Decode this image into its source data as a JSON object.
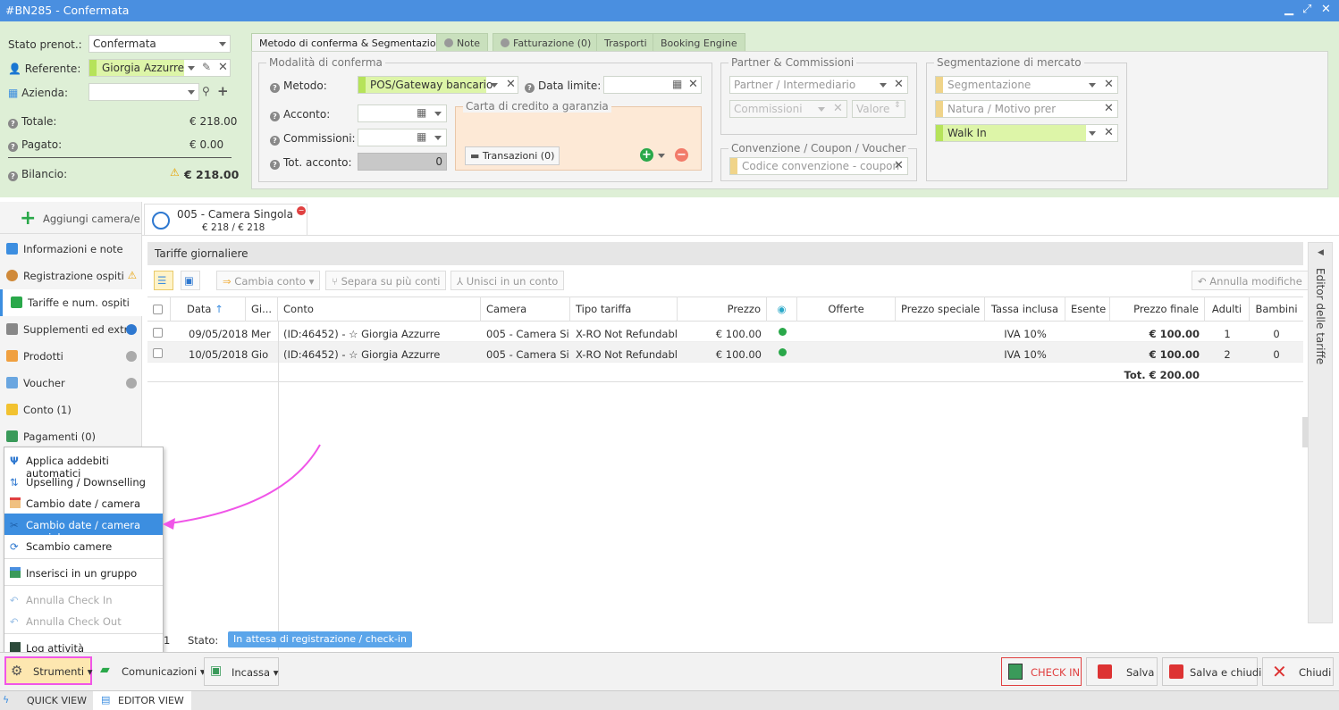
{
  "window": {
    "title": "#BN285 - Confermata"
  },
  "left_summary": {
    "stato_label": "Stato prenot.:",
    "stato_value": "Confermata",
    "referente_label": "Referente:",
    "referente_value": "Giorgia Azzurre",
    "azienda_label": "Azienda:",
    "azienda_value": "",
    "totale_label": "Totale:",
    "totale_value": "€ 218.00",
    "pagato_label": "Pagato:",
    "pagato_value": "€ 0.00",
    "bilancio_label": "Bilancio:",
    "bilancio_value": "€ 218.00"
  },
  "top_tabs": [
    "Metodo di conferma & Segmentazione",
    "Note",
    "Fatturazione (0)",
    "Trasporti",
    "Booking Engine"
  ],
  "conferma": {
    "legend": "Modalità di conferma",
    "metodo_label": "Metodo:",
    "metodo_value": "POS/Gateway bancario",
    "data_limite_label": "Data limite:",
    "acconto_label": "Acconto:",
    "commissioni_label": "Commissioni:",
    "tot_acconto_label": "Tot. acconto:",
    "tot_acconto_value": "0",
    "carta_legend": "Carta di credito a garanzia",
    "transazioni_label": "Transazioni (0)"
  },
  "partner": {
    "legend": "Partner & Commissioni",
    "intermediario_placeholder": "Partner / Intermediario",
    "commissioni_placeholder": "Commissioni",
    "valore_placeholder": "Valore"
  },
  "convenzione": {
    "legend": "Convenzione / Coupon / Voucher",
    "placeholder": "Codice convenzione - coupon"
  },
  "segmentazione": {
    "legend": "Segmentazione di mercato",
    "segmentazione_placeholder": "Segmentazione",
    "natura_placeholder": "Natura / Motivo prenotazione",
    "canale_value": "Walk In"
  },
  "sidebar": {
    "add_room": "Aggiungi camera/e",
    "items": [
      {
        "label": "Informazioni e note"
      },
      {
        "label": "Registrazione ospiti"
      },
      {
        "label": "Tariffe e num. ospiti"
      },
      {
        "label": "Supplementi ed extra"
      },
      {
        "label": "Prodotti"
      },
      {
        "label": "Voucher"
      },
      {
        "label": "Conto (1)"
      },
      {
        "label": "Pagamenti (0)"
      }
    ]
  },
  "room_tab": {
    "title": "005 - Camera Singola",
    "subtitle": "€ 218 / € 218"
  },
  "section_title": "Tariffe giornaliere",
  "toolbar": {
    "cambia_conto": "Cambia conto",
    "separa": "Separa su più conti",
    "unisci": "Unisci in un conto",
    "annulla": "Annulla modifiche"
  },
  "table": {
    "headers": [
      "Data",
      "Gi...",
      "Conto",
      "Camera",
      "Tipo tariffa",
      "Prezzo",
      "Offerte",
      "Prezzo speciale",
      "Tassa inclusa",
      "Esente",
      "Prezzo finale",
      "Adulti",
      "Bambini"
    ],
    "rows": [
      {
        "data": "09/05/2018",
        "giorno": "Mer",
        "conto": "(ID:46452) - ☆ Giorgia Azzurre",
        "camera": "005 - Camera Si...",
        "tipo": "X-RO Not Refundable",
        "prezzo": "€ 100.00",
        "tassa": "IVA 10%",
        "finale": "€ 100.00",
        "adulti": "1",
        "bambini": "0"
      },
      {
        "data": "10/05/2018",
        "giorno": "Gio",
        "conto": "(ID:46452) - ☆ Giorgia Azzurre",
        "camera": "005 - Camera Si...",
        "tipo": "X-RO Not Refundable",
        "prezzo": "€ 100.00",
        "tassa": "IVA 10%",
        "finale": "€ 100.00",
        "adulti": "2",
        "bambini": "0"
      }
    ],
    "total": "Tot. € 200.00"
  },
  "right_panel": {
    "label": "Editor delle tariffe"
  },
  "status": {
    "count": "1",
    "label": "Stato:",
    "badge": "In attesa di registrazione / check-in"
  },
  "tools_menu": {
    "items": [
      "Applica addebiti automatici",
      "Upselling / Downselling",
      "Cambio date / camera",
      "Cambio date / camera parziale",
      "Scambio camere",
      "Inserisci in un gruppo",
      "Annulla Check In",
      "Annulla Check Out",
      "Log attività"
    ]
  },
  "bottom": {
    "strumenti": "Strumenti",
    "comunicazioni": "Comunicazioni",
    "incassa": "Incassa",
    "checkin": "CHECK IN",
    "salva": "Salva",
    "salva_chiudi": "Salva e chiudi",
    "chiudi": "Chiudi"
  },
  "views": {
    "quick": "QUICK VIEW",
    "editor": "EDITOR VIEW"
  },
  "colors": {
    "accent": "#3c8ee0",
    "highlight_pink": "#f055e8",
    "green_bg": "#deefd6",
    "lime": "#ddf5a8"
  }
}
